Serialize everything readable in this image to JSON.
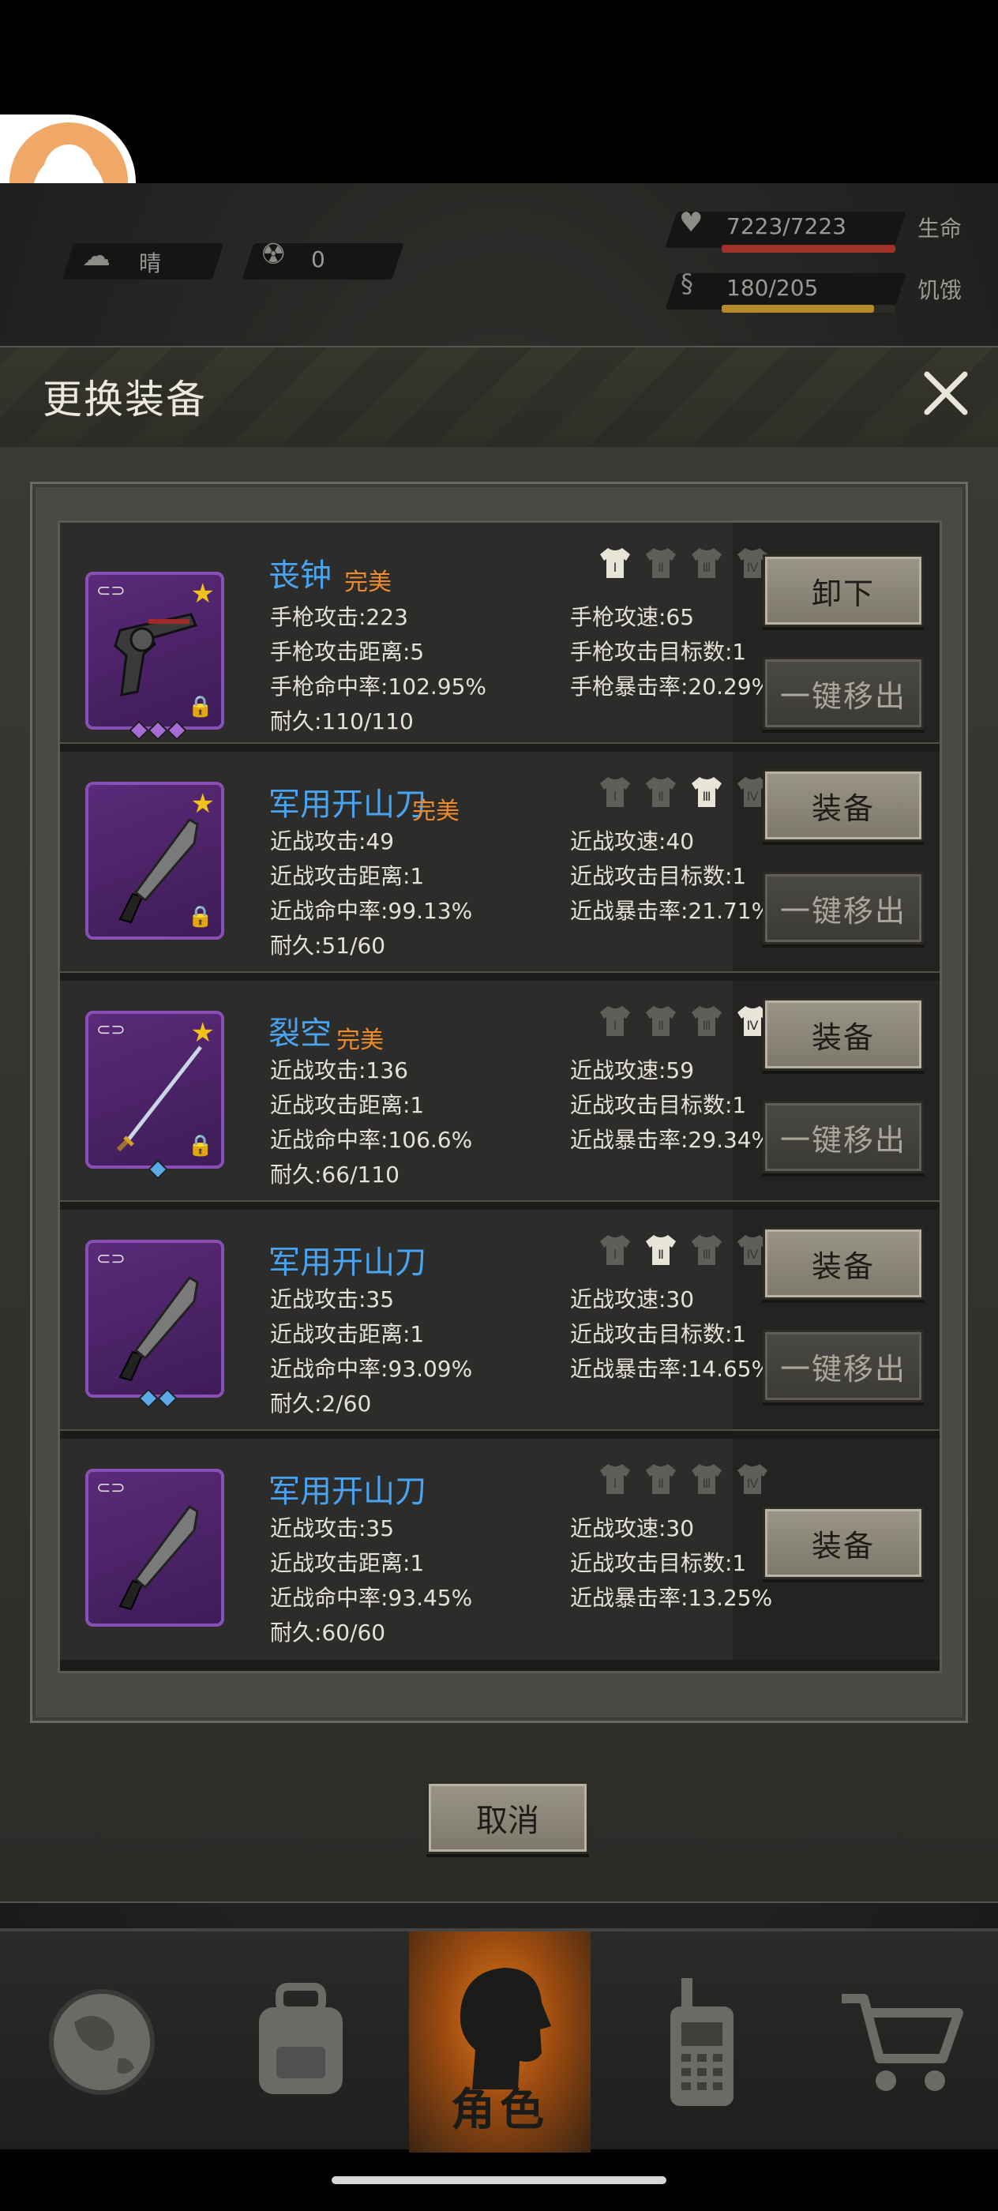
{
  "hud": {
    "weather": "晴",
    "radiation": "0",
    "health": "7223/7223",
    "health_label": "生命",
    "hunger": "180/205",
    "hunger_label": "饥饿"
  },
  "dialog": {
    "title": "更换装备",
    "cancel_label": "取消"
  },
  "items": [
    {
      "name": "丧钟",
      "quality": "完美",
      "stats_left": [
        "手枪攻击:223",
        "手枪攻击距离:5",
        "手枪命中率:102.95%",
        "耐久:110/110"
      ],
      "stats_right": [
        "手枪攻速:65",
        "手枪攻击目标数:1",
        "手枪暴击率:20.29%"
      ],
      "primary_button": "卸下",
      "secondary_button": "一键移出",
      "gems": [
        "purple",
        "purple",
        "purple"
      ],
      "slots": [
        "Ⅰ",
        "Ⅱ",
        "Ⅲ",
        "Ⅳ"
      ],
      "active_slot": 0
    },
    {
      "name": "军用开山刀",
      "quality": "完美",
      "stats_left": [
        "近战攻击:49",
        "近战攻击距离:1",
        "近战命中率:99.13%",
        "耐久:51/60"
      ],
      "stats_right": [
        "近战攻速:40",
        "近战攻击目标数:1",
        "近战暴击率:21.71%"
      ],
      "primary_button": "装备",
      "secondary_button": "一键移出",
      "gems": [],
      "slots": [
        "Ⅰ",
        "Ⅱ",
        "Ⅲ",
        "Ⅳ"
      ],
      "active_slot": 2
    },
    {
      "name": "裂空",
      "quality": "完美",
      "stats_left": [
        "近战攻击:136",
        "近战攻击距离:1",
        "近战命中率:106.6%",
        "耐久:66/110"
      ],
      "stats_right": [
        "近战攻速:59",
        "近战攻击目标数:1",
        "近战暴击率:29.34%"
      ],
      "primary_button": "装备",
      "secondary_button": "一键移出",
      "gems": [
        "blue"
      ],
      "slots": [
        "Ⅰ",
        "Ⅱ",
        "Ⅲ",
        "Ⅳ"
      ],
      "active_slot": 3
    },
    {
      "name": "军用开山刀",
      "quality": "",
      "stats_left": [
        "近战攻击:35",
        "近战攻击距离:1",
        "近战命中率:93.09%",
        "耐久:2/60"
      ],
      "stats_right": [
        "近战攻速:30",
        "近战攻击目标数:1",
        "近战暴击率:14.65%"
      ],
      "primary_button": "装备",
      "secondary_button": "一键移出",
      "gems": [
        "blue",
        "blue"
      ],
      "slots": [
        "Ⅰ",
        "Ⅱ",
        "Ⅲ",
        "Ⅳ"
      ],
      "active_slot": 1
    },
    {
      "name": "军用开山刀",
      "quality": "",
      "stats_left": [
        "近战攻击:35",
        "近战攻击距离:1",
        "近战命中率:93.45%",
        "耐久:60/60"
      ],
      "stats_right": [
        "近战攻速:30",
        "近战攻击目标数:1",
        "近战暴击率:13.25%"
      ],
      "primary_button": "装备",
      "secondary_button": "",
      "gems": [],
      "slots": [
        "Ⅰ",
        "Ⅱ",
        "Ⅲ",
        "Ⅳ"
      ],
      "active_slot": -1
    }
  ],
  "nav": {
    "character_label": "角色"
  },
  "colors": {
    "name_blue": "#4aa3f0",
    "quality_orange": "#f08a2a",
    "rarity_purple": "#8a4fb4",
    "nav_active": "#e07a1c"
  }
}
